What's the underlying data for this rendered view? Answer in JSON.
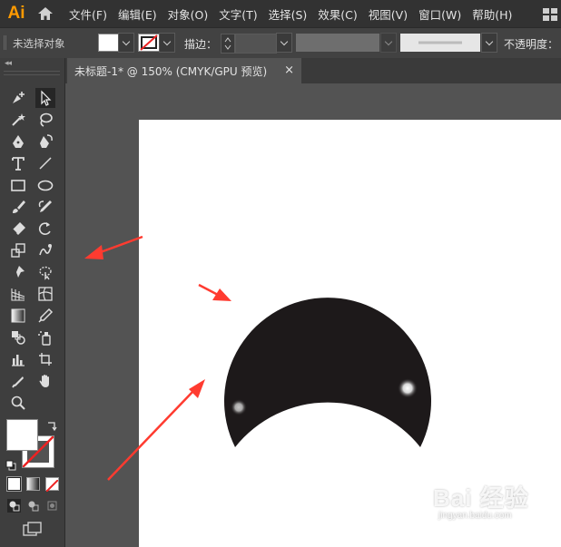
{
  "app": {
    "logo": "Ai"
  },
  "menu": {
    "items": [
      "文件(F)",
      "编辑(E)",
      "对象(O)",
      "文字(T)",
      "选择(S)",
      "效果(C)",
      "视图(V)",
      "窗口(W)",
      "帮助(H)"
    ]
  },
  "control_bar": {
    "selection_label": "未选择对象",
    "stroke_label": "描边：",
    "opacity_label": "不透明度："
  },
  "document": {
    "tab_title": "未标题-1* @ 150% (CMYK/GPU 预览)",
    "close_glyph": "×"
  },
  "colors": {
    "accent_logo": "#ff9a00",
    "annotation_arrow": "#ff3b30",
    "shape_fill": "#1d191a",
    "artboard": "#ffffff"
  },
  "tools": [
    "add-anchor-point-tool",
    "selection-tool",
    "magic-wand-tool",
    "lasso-tool",
    "pen-tool",
    "curvature-tool",
    "type-tool",
    "line-segment-tool",
    "rectangle-tool",
    "ellipse-tool",
    "paintbrush-tool",
    "pencil-tool",
    "eraser-tool",
    "rotate-tool",
    "scale-tool",
    "warp-tool",
    "puppet-warp-tool",
    "shape-builder-tool",
    "perspective-grid-tool",
    "mesh-tool",
    "gradient-tool",
    "eyedropper-tool",
    "blend-tool",
    "symbol-sprayer-tool",
    "column-graph-tool",
    "artboard-tool",
    "slice-tool",
    "hand-tool",
    "zoom-tool"
  ],
  "watermark": {
    "brand": "Bai 经验",
    "url": "jingyan.baidu.com"
  }
}
